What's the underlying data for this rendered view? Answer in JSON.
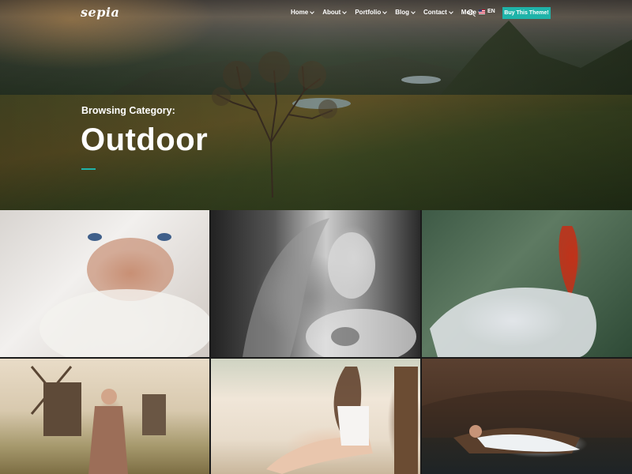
{
  "brand": {
    "logo": "sepia"
  },
  "nav": {
    "items": [
      {
        "label": "Home"
      },
      {
        "label": "About"
      },
      {
        "label": "Portfolio"
      },
      {
        "label": "Blog"
      },
      {
        "label": "Contact"
      },
      {
        "label": "More"
      }
    ],
    "language": "EN",
    "cta_label": "Buy This Theme!"
  },
  "hero": {
    "subtitle": "Browsing Category:",
    "title": "Outdoor"
  },
  "colors": {
    "accent": "#1fb3a9"
  },
  "icons": [
    "search-icon",
    "flag-us-icon",
    "chevron-down-icon"
  ]
}
